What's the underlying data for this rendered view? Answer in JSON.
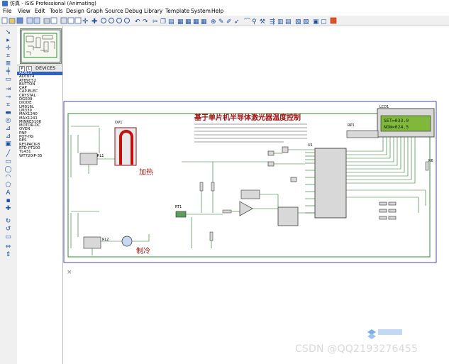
{
  "window": {
    "title": "仿真 - ISIS Professional (Animating)"
  },
  "menu": [
    "File",
    "View",
    "Edit",
    "Tools",
    "Design",
    "Graph",
    "Source",
    "Debug",
    "Library",
    "Template",
    "System",
    "Help"
  ],
  "devices_panel": {
    "tab_p": "P",
    "tab_l": "L",
    "header": "DEVICES",
    "items": [
      "AD620",
      "ADT674",
      "AT89C52",
      "BUTTON",
      "CAP",
      "CAP-ELEC",
      "CRYSTAL",
      "DG509",
      "DIODE",
      "LM016L",
      "LM339",
      "MAX1240",
      "MAX1241",
      "MINRES10K",
      "MOTOR-DC",
      "OVEN",
      "PNP",
      "POT-HG",
      "RES",
      "RESPACK-8",
      "RTD-PT100",
      "TL431",
      "WT720IP-35"
    ],
    "selected_index": 0
  },
  "schematic": {
    "title": "基于单片机半导体激光器温度控制",
    "lcd_label": "LCD1",
    "lcd_line1": "SET=033.0",
    "lcd_line2": "NOW=024.5",
    "heat_label": "加热",
    "cool_label": "制冷",
    "oven_ref": "OV1",
    "u1_ref": "U1",
    "rp1_ref": "RP1",
    "rt1_ref": "RT1",
    "rl1_ref": "RL1",
    "rl2_ref": "RL2",
    "r6_ref": "R6",
    "cross": "×"
  },
  "watermark": "CSDN @QQ2193276455",
  "colors": {
    "wire": "#1c7a1c",
    "component": "#a01010",
    "frame": "#1a1aa0",
    "lcd_bg": "#7fb83b",
    "select": "#3060c0"
  }
}
